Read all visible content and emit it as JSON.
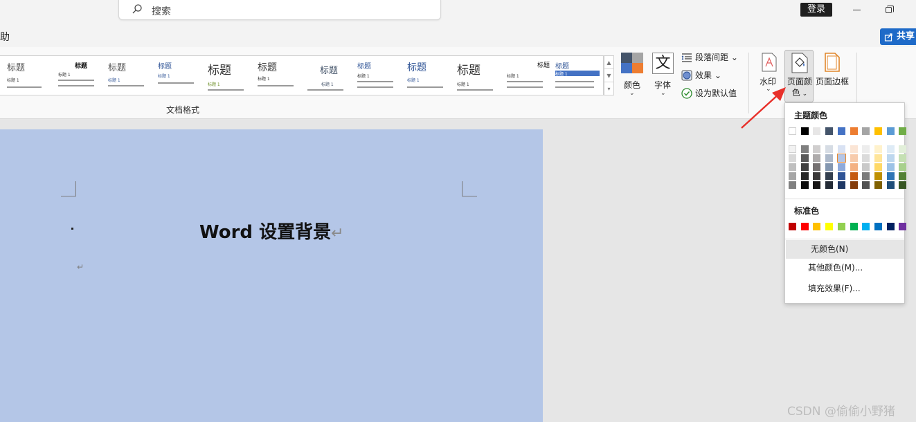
{
  "titlebar": {
    "search_placeholder": "搜索",
    "login_label": "登录"
  },
  "tabs": {
    "partial_tab": "助",
    "share_label": "共享"
  },
  "ribbon": {
    "gallery_group_label": "文档格式",
    "styles": [
      {
        "title": "标题",
        "subtitle": "标题 1"
      },
      {
        "title": "标题",
        "subtitle": "标题 1"
      },
      {
        "title": "标题",
        "subtitle": "标题 1"
      },
      {
        "title": "标题",
        "subtitle": "标题 1"
      },
      {
        "title": "标题",
        "subtitle": "标题 1"
      },
      {
        "title": "标题",
        "subtitle": "标题 1"
      },
      {
        "title": "标题",
        "subtitle": "标题 1"
      },
      {
        "title": "标题",
        "subtitle": "标题 1"
      },
      {
        "title": "标题",
        "subtitle": "标题 1"
      },
      {
        "title": "标题",
        "subtitle": "标题 1"
      },
      {
        "title": "标题",
        "subtitle": "标题 1"
      },
      {
        "title": "标题",
        "subtitle": "标题 1"
      }
    ],
    "colors_label": "颜色",
    "fonts_label": "字体",
    "fonts_glyph": "文",
    "paragraph_spacing_label": "段落间距",
    "effects_label": "效果",
    "set_default_label": "设为默认值",
    "watermark_label": "水印",
    "page_color_label_line1": "页面颜",
    "page_color_label_line2": "色",
    "page_border_label": "页面边框"
  },
  "document": {
    "heading": "Word 设置背景",
    "page_background": "#b4c6e7"
  },
  "dropdown": {
    "theme_colors_heading": "主题颜色",
    "standard_colors_heading": "标准色",
    "theme_top_row": [
      "#ffffff",
      "#000000",
      "#e7e6e6",
      "#44546a",
      "#4472c4",
      "#ed7d31",
      "#a5a5a5",
      "#ffc000",
      "#5b9bd5",
      "#70ad47"
    ],
    "theme_shades": [
      [
        "#f2f2f2",
        "#d9d9d9",
        "#bfbfbf",
        "#a6a6a6",
        "#808080"
      ],
      [
        "#7f7f7f",
        "#595959",
        "#404040",
        "#262626",
        "#0d0d0d"
      ],
      [
        "#d0cece",
        "#aeabab",
        "#757171",
        "#3a3838",
        "#171616"
      ],
      [
        "#d6dce4",
        "#adb9ca",
        "#8497b0",
        "#333f4f",
        "#222a35"
      ],
      [
        "#d9e2f3",
        "#b4c6e7",
        "#8eaadb",
        "#2f5496",
        "#1f3864"
      ],
      [
        "#fbe5d5",
        "#f7cbac",
        "#f4b183",
        "#c55a11",
        "#843c0b"
      ],
      [
        "#ededed",
        "#dbdbdb",
        "#c9c9c9",
        "#7b7b7b",
        "#525252"
      ],
      [
        "#fff2cc",
        "#ffe599",
        "#ffd966",
        "#bf9000",
        "#7f6000"
      ],
      [
        "#deebf6",
        "#bdd7ee",
        "#9dc3e6",
        "#2e75b5",
        "#1f4e79"
      ],
      [
        "#e2efd9",
        "#c5e0b3",
        "#a8d08d",
        "#538135",
        "#375623"
      ]
    ],
    "standard_colors": [
      "#c00000",
      "#ff0000",
      "#ffc000",
      "#ffff00",
      "#92d050",
      "#00b050",
      "#00b0f0",
      "#0070c0",
      "#002060",
      "#7030a0"
    ],
    "no_color_label": "无颜色(N)",
    "more_colors_label": "其他颜色(M)...",
    "fill_effects_label": "填充效果(F)..."
  },
  "watermark_text": "CSDN @偷偷小野猪",
  "colors": {
    "accent_blue": "#1e6ac8",
    "arrow_red": "#e8302a"
  }
}
